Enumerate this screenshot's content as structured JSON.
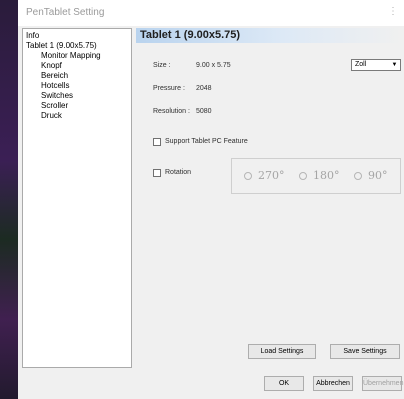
{
  "window": {
    "title": "PenTablet Setting",
    "menu_glyph": "⋮"
  },
  "tree": {
    "items": [
      {
        "label": "Info",
        "level": 0
      },
      {
        "label": "Tablet 1 (9.00x5.75)",
        "level": 0
      },
      {
        "label": "Monitor Mapping",
        "level": 1
      },
      {
        "label": "Knopf",
        "level": 1
      },
      {
        "label": "Bereich",
        "level": 1
      },
      {
        "label": "Hotcells",
        "level": 1
      },
      {
        "label": "Switches",
        "level": 1
      },
      {
        "label": "Scroller",
        "level": 1
      },
      {
        "label": "Druck",
        "level": 1
      }
    ]
  },
  "panel": {
    "header": "Tablet 1 (9.00x5.75)",
    "size_label": "Size :",
    "size_value": "9.00 x 5.75",
    "unit_selected": "Zoll",
    "pressure_label": "Pressure :",
    "pressure_value": "2048",
    "resolution_label": "Resolution :",
    "resolution_value": "5080",
    "support_label": "Support Tablet PC Feature",
    "rotation_label": "Rotation",
    "rotation_options": [
      "270°",
      "180°",
      "90°"
    ]
  },
  "buttons": {
    "load": "Load Settings",
    "save": "Save Settings",
    "ok": "OK",
    "cancel": "Abbrechen",
    "apply": "Übernehmen"
  }
}
